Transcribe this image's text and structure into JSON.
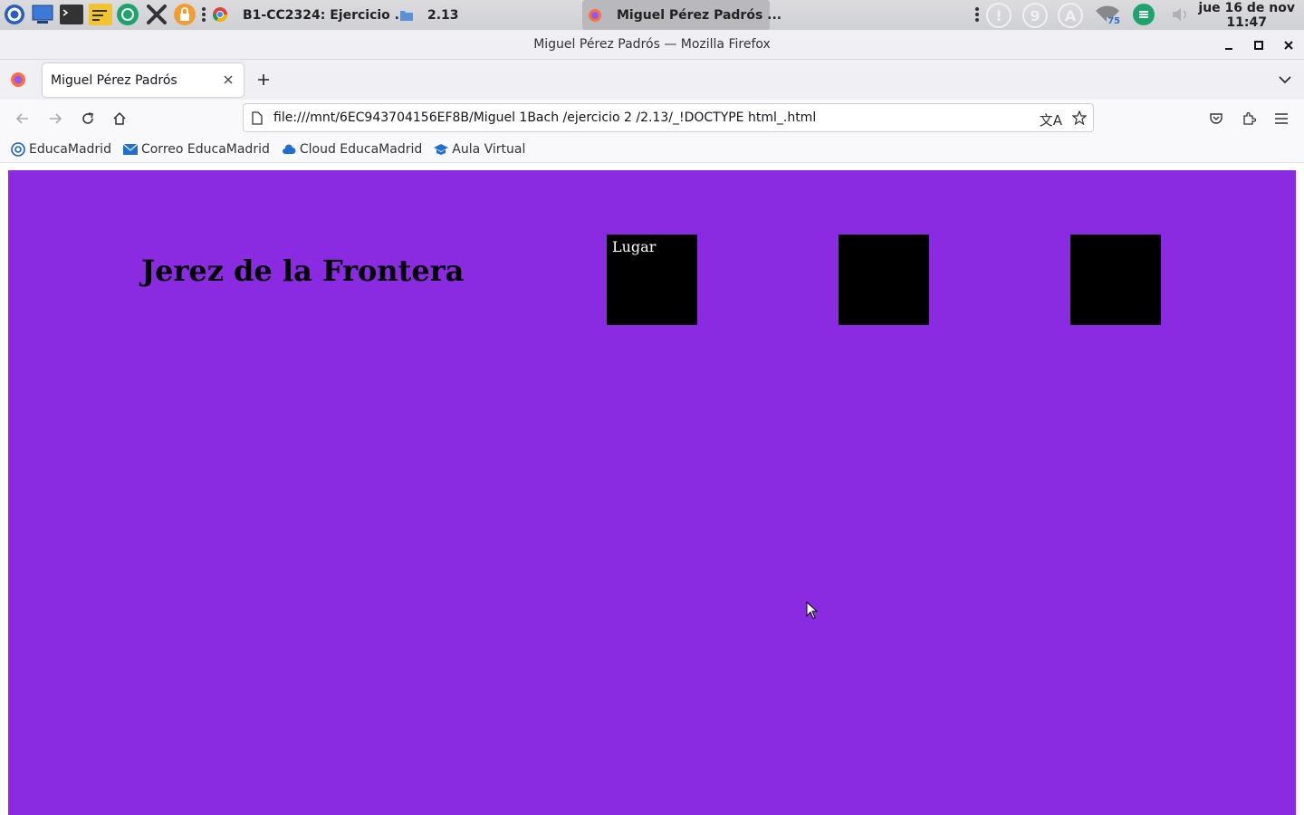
{
  "system_panel": {
    "tasks": [
      {
        "label": "B1-CC2324: Ejercicio ..."
      },
      {
        "label": "2.13"
      },
      {
        "label": "Miguel Pérez Padrós ..."
      }
    ],
    "tray_circles": [
      "!",
      "9",
      "A"
    ],
    "battery_level": "75",
    "clock": {
      "date": "jue 16 de nov",
      "time": "11:47"
    }
  },
  "window": {
    "title": "Miguel Pérez Padrós — Mozilla Firefox",
    "buttons": {
      "minimize": "–",
      "maximize": "□",
      "close": "✕"
    }
  },
  "tab": {
    "label": "Miguel Pérez Padrós",
    "close": "✕",
    "new_tab": "+",
    "list_all": "⌄"
  },
  "nav": {
    "url": "file:///mnt/6EC943704156EF8B/Miguel 1Bach /ejercicio 2 /2.13/_!DOCTYPE html_.html"
  },
  "bookmarks": [
    {
      "label": "EducaMadrid"
    },
    {
      "label": "Correo EducaMadrid"
    },
    {
      "label": "Cloud EducaMadrid"
    },
    {
      "label": "Aula Virtual"
    }
  ],
  "page": {
    "background": "#8a2be2",
    "heading": "Jerez de la Frontera",
    "boxes": [
      {
        "label": "Lugar"
      },
      {
        "label": ""
      },
      {
        "label": ""
      }
    ]
  }
}
